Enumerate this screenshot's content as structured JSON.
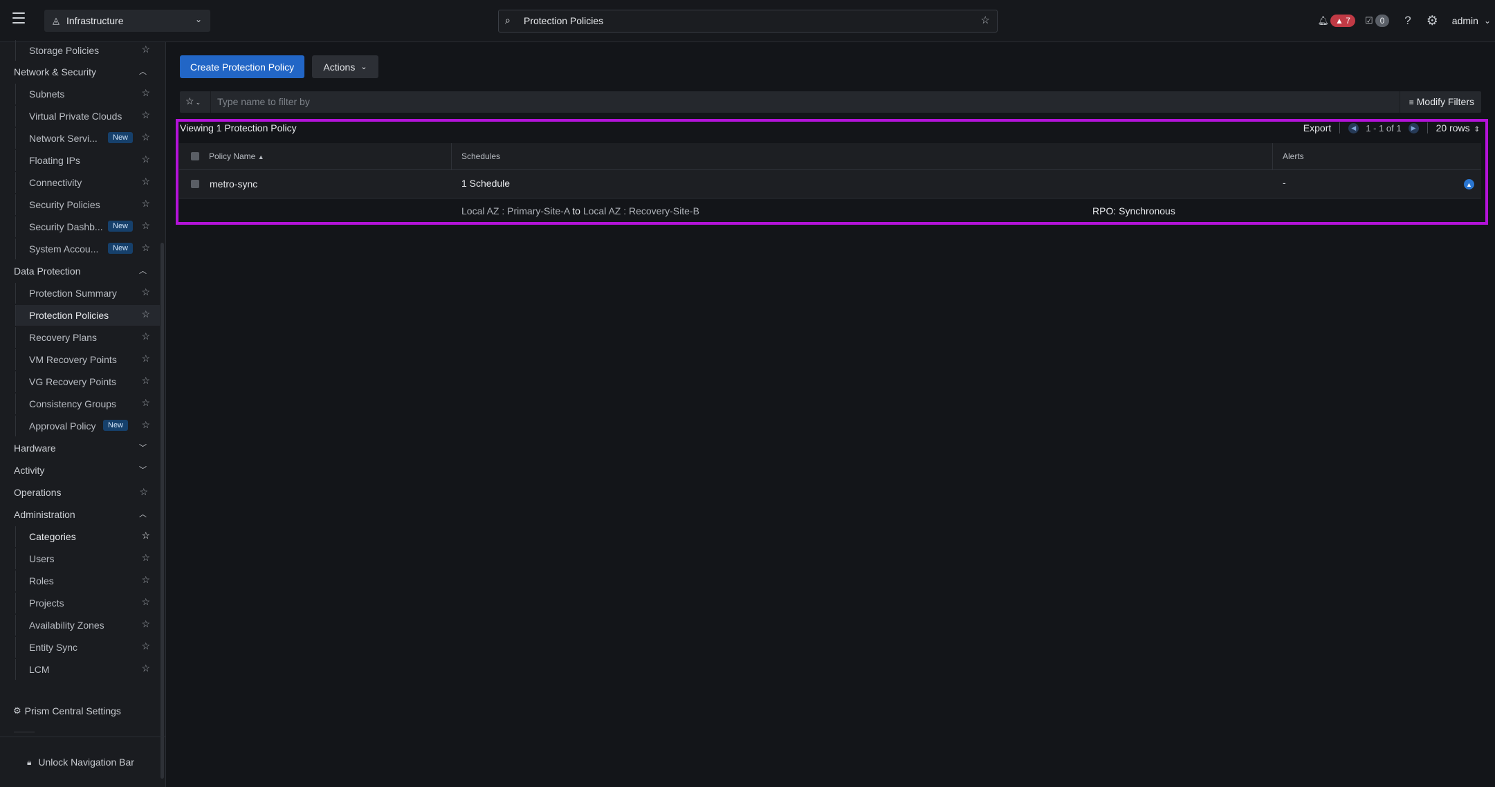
{
  "header": {
    "app_name": "Infrastructure",
    "search_value": "Protection Policies",
    "alert_count": "7",
    "task_count": "0",
    "user": "admin"
  },
  "sidebar": {
    "storage_policies": "Storage Policies",
    "network_security": "Network & Security",
    "subnets": "Subnets",
    "vpcs": "Virtual Private Clouds",
    "network_services": "Network Servi...",
    "floating_ips": "Floating IPs",
    "connectivity": "Connectivity",
    "security_policies": "Security Policies",
    "security_dashboard": "Security Dashb...",
    "system_accounts": "System Accou...",
    "data_protection": "Data Protection",
    "protection_summary": "Protection Summary",
    "protection_policies": "Protection Policies",
    "recovery_plans": "Recovery Plans",
    "vm_recovery_points": "VM Recovery Points",
    "vg_recovery_points": "VG Recovery Points",
    "consistency_groups": "Consistency Groups",
    "approval_policy": "Approval Policy",
    "hardware": "Hardware",
    "activity": "Activity",
    "operations": "Operations",
    "administration": "Administration",
    "categories": "Categories",
    "users": "Users",
    "roles": "Roles",
    "projects": "Projects",
    "availability_zones": "Availability Zones",
    "entity_sync": "Entity Sync",
    "lcm": "LCM",
    "new_badge": "New",
    "prism_central_settings": "Prism Central Settings",
    "unlock_nav": "Unlock Navigation Bar"
  },
  "main": {
    "create_button": "Create Protection Policy",
    "actions_button": "Actions",
    "filter_placeholder": "Type name to filter by",
    "modify_filters": "Modify Filters",
    "viewing_text": "Viewing 1 Protection Policy",
    "export": "Export",
    "page_info": "1 - 1 of 1",
    "rows_per_page": "20 rows"
  },
  "table": {
    "columns": [
      "Policy Name",
      "Schedules",
      "Alerts"
    ],
    "rows": [
      {
        "name": "metro-sync",
        "schedules": "1 Schedule",
        "alerts": "-",
        "detail": {
          "src_label": "Local AZ : Primary-Site-A",
          "to": "to",
          "dst_label": "Local AZ : Recovery-Site-B",
          "rpo": "RPO: Synchronous"
        }
      }
    ]
  }
}
